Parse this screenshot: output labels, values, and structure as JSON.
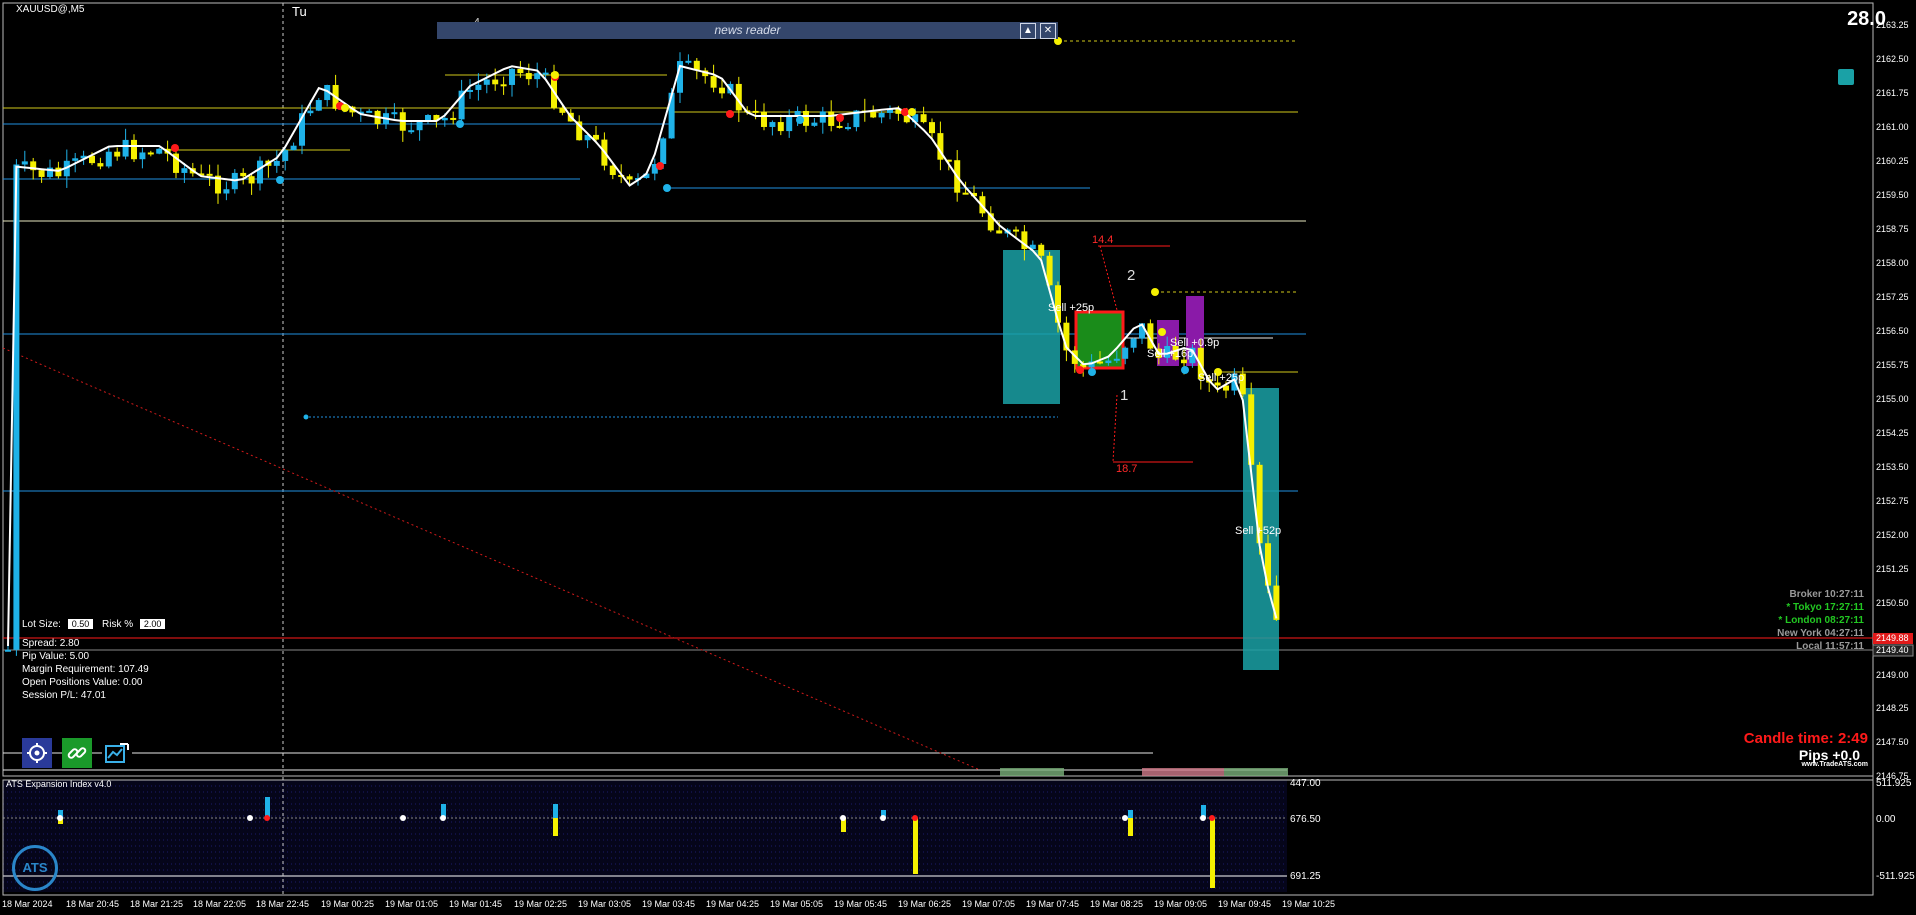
{
  "symbol": "XAUUSD@,M5",
  "day_marker": "Tu",
  "top_right_value": "28.0",
  "news_reader": {
    "title": "news reader",
    "up_icon": "▲",
    "close_icon": "✕"
  },
  "trade_panel": {
    "lot_size_label": "Lot Size:",
    "lot_size": "0.50",
    "risk_label": "Risk %",
    "risk": "2.00",
    "spread": "Spread: 2.80",
    "pip_value": "Pip Value: 5.00",
    "margin": "Margin Requirement: 107.49",
    "open_positions": "Open Positions Value: 0.00",
    "session_pl": "Session P/L: 47.01"
  },
  "sessions": [
    {
      "label": "Broker  10:27:11",
      "color": "#9a9a9a"
    },
    {
      "label": "* Tokyo  17:27:11",
      "color": "#22c722"
    },
    {
      "label": "* London  08:27:11",
      "color": "#22c722"
    },
    {
      "label": "New York  04:27:11",
      "color": "#9a9a9a"
    },
    {
      "label": "Local  11:57:11",
      "color": "#9a9a9a"
    }
  ],
  "candle_time": "Candle time:  2:49",
  "pips": "Pips +0.0",
  "website": "www.TradeATS.com",
  "price_axis": [
    "2163.25",
    "2162.50",
    "2161.75",
    "2161.00",
    "2160.25",
    "2159.50",
    "2158.75",
    "2158.00",
    "2157.25",
    "2156.50",
    "2155.75",
    "2155.00",
    "2154.25",
    "2153.50",
    "2152.75",
    "2152.00",
    "2151.25",
    "2150.50",
    "2149.00",
    "2148.25",
    "2147.50",
    "2146.75"
  ],
  "price_axis_current": "2149.40",
  "price_axis_bid": "2149.88",
  "indicator": {
    "title": "ATS Expansion Index v4.0",
    "levels": [
      "447.00",
      "676.50",
      "691.25"
    ],
    "right_levels": [
      "511.925",
      "0.00",
      "-511.925"
    ],
    "logo": "ATS"
  },
  "time_axis": [
    "18 Mar 2024",
    "18 Mar 20:45",
    "18 Mar 21:25",
    "18 Mar 22:05",
    "18 Mar 22:45",
    "19 Mar 00:25",
    "19 Mar 01:05",
    "19 Mar 01:45",
    "19 Mar 02:25",
    "19 Mar 03:05",
    "19 Mar 03:45",
    "19 Mar 04:25",
    "19 Mar 05:05",
    "19 Mar 05:45",
    "19 Mar 06:25",
    "19 Mar 07:05",
    "19 Mar 07:45",
    "19 Mar 08:25",
    "19 Mar 09:05",
    "19 Mar 09:45",
    "19 Mar 10:25"
  ],
  "markers": {
    "wave_4": "4",
    "wave_1": "1",
    "wave_2": "2",
    "fib_144": "14.4",
    "fib_187": "18.7",
    "sell_1": "Sell +25p",
    "sell_2": "Sell +16p",
    "sell_3": "Sell +25p",
    "sell_4": "Sell +52p",
    "sell_5": "Sell +0.9p"
  },
  "colors": {
    "bull": "#1fb2e8",
    "bear": "#f5f000",
    "ma": "#ffffff",
    "teal_box": "#1aa1a6",
    "green_box": "#1a8c1a",
    "purple_box": "#8a1aa8",
    "red_line": "#ff1a1a",
    "blue_line": "#1f8fe0",
    "yellow_line": "#d0c81a"
  }
}
